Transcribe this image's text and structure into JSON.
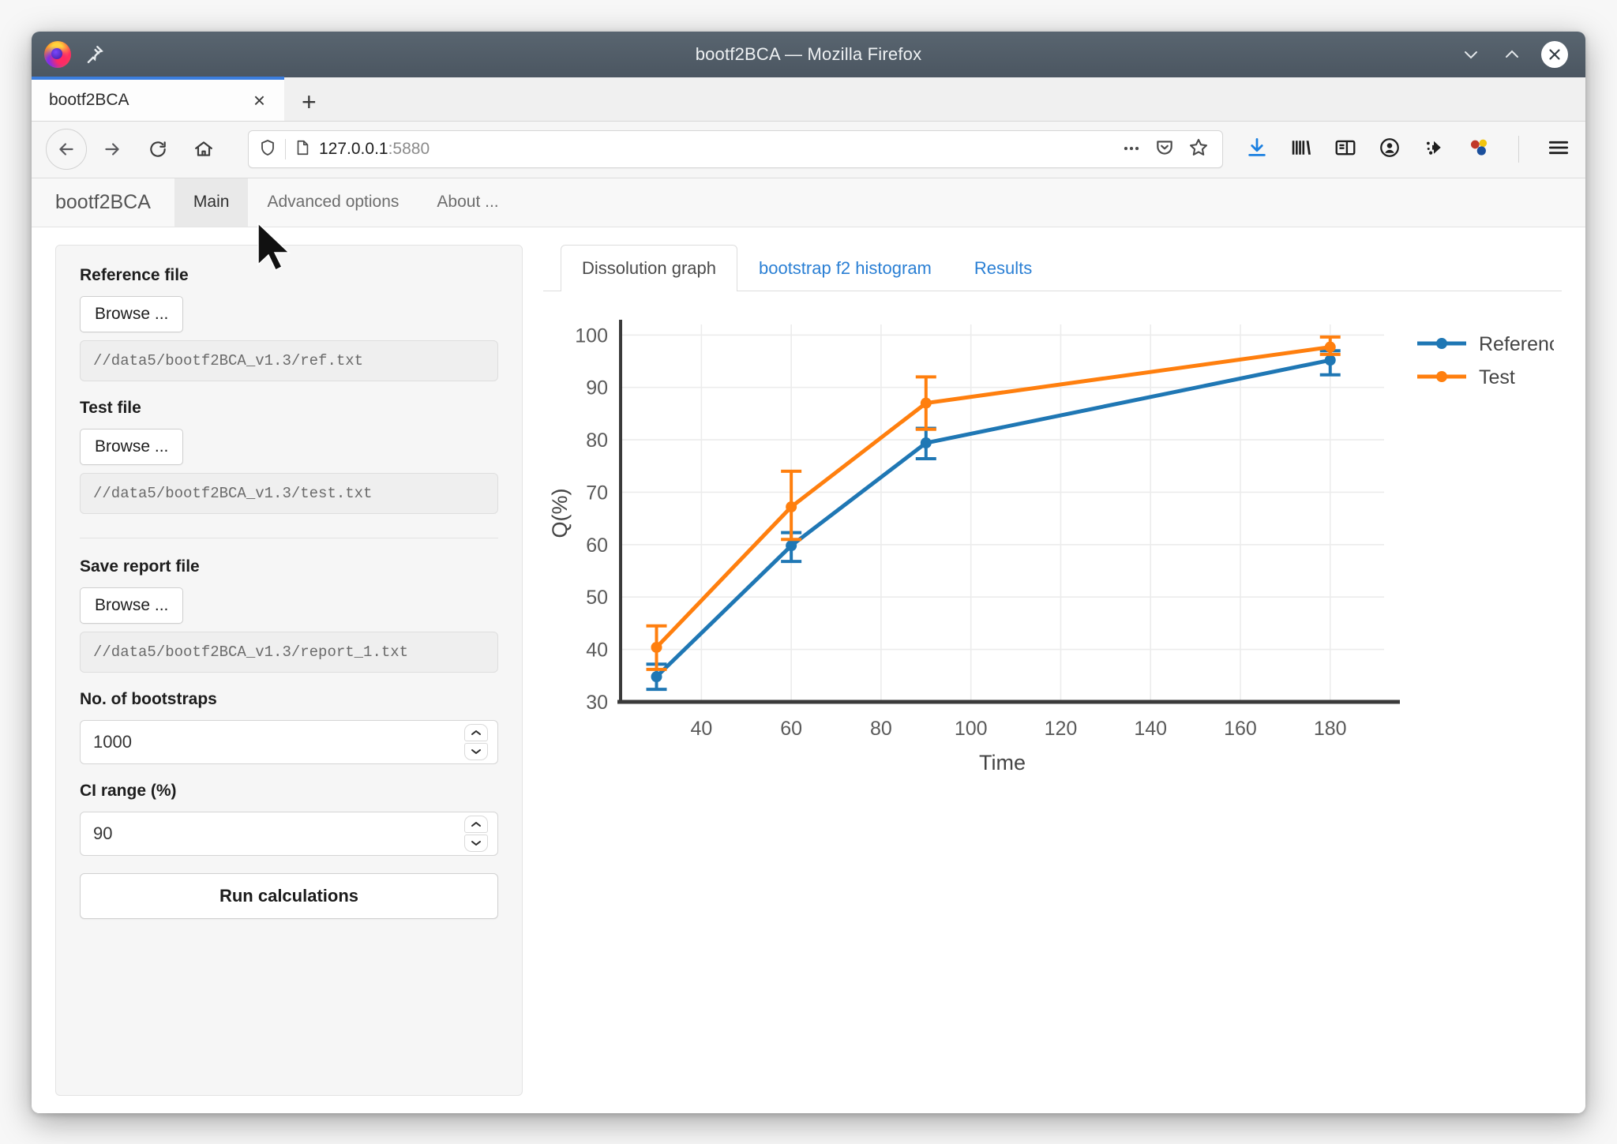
{
  "window": {
    "title": "bootf2BCA — Mozilla Firefox",
    "minimize_icon": "chevron-down-icon",
    "maximize_icon": "chevron-up-icon",
    "close_icon": "close-icon"
  },
  "browser": {
    "tab_label": "bootf2BCA",
    "tab_close_label": "×",
    "new_tab_label": "+",
    "url_host": "127.0.0.1",
    "url_port": ":5880",
    "nav_icons": [
      "back-icon",
      "forward-icon",
      "reload-icon",
      "home-icon"
    ],
    "url_icons": [
      "shield-icon",
      "page-icon"
    ],
    "url_right_icons": [
      "ellipsis-icon",
      "pocket-icon",
      "bookmark-star-icon"
    ],
    "toolbar_icons": [
      "downloads-icon",
      "library-icon",
      "sidebar-icon",
      "account-icon",
      "extension-icon",
      "molecule-icon",
      "hamburger-menu-icon"
    ]
  },
  "app_nav": {
    "brand": "bootf2BCA",
    "items": [
      {
        "label": "Main",
        "active": true
      },
      {
        "label": "Advanced options",
        "active": false
      },
      {
        "label": "About ...",
        "active": false
      }
    ]
  },
  "sidebar": {
    "reference_file": {
      "label": "Reference file",
      "browse_label": "Browse ...",
      "path": "//data5/bootf2BCA_v1.3/ref.txt"
    },
    "test_file": {
      "label": "Test file",
      "browse_label": "Browse ...",
      "path": "//data5/bootf2BCA_v1.3/test.txt"
    },
    "save_report_file": {
      "label": "Save report file",
      "browse_label": "Browse ...",
      "path": "//data5/bootf2BCA_v1.3/report_1.txt"
    },
    "bootstraps": {
      "label": "No. of bootstraps",
      "value": "1000"
    },
    "ci_range": {
      "label": "CI range (%)",
      "value": "90"
    },
    "run_button": "Run calculations"
  },
  "panel_tabs": [
    {
      "label": "Dissolution graph",
      "active": true
    },
    {
      "label": "bootstrap f2 histogram",
      "active": false
    },
    {
      "label": "Results",
      "active": false
    }
  ],
  "colors": {
    "reference": "#1f77b4",
    "test": "#ff7f0e",
    "tab_link": "#2a7fd4",
    "titlebar": "#4f5a65"
  },
  "chart_data": {
    "type": "line",
    "title": "",
    "xlabel": "Time",
    "ylabel": "Q(%)",
    "x": [
      30,
      60,
      90,
      180
    ],
    "xlim": [
      22,
      192
    ],
    "ylim": [
      30,
      102
    ],
    "xticks": [
      40,
      60,
      80,
      100,
      120,
      140,
      160,
      180
    ],
    "yticks": [
      30,
      40,
      50,
      60,
      70,
      80,
      90,
      100
    ],
    "grid": true,
    "legend_position": "right",
    "series": [
      {
        "name": "Reference",
        "color": "#1f77b4",
        "values": [
          34.8,
          59.8,
          79.4,
          95.2
        ],
        "err_low": [
          32.4,
          56.8,
          76.4,
          92.4
        ],
        "err_high": [
          37.2,
          62.3,
          82.2,
          97.0
        ]
      },
      {
        "name": "Test",
        "color": "#ff7f0e",
        "values": [
          40.4,
          67.2,
          87.0,
          97.7
        ],
        "err_low": [
          36.2,
          61.0,
          82.0,
          96.3
        ],
        "err_high": [
          44.5,
          74.0,
          92.0,
          99.6
        ]
      }
    ]
  }
}
